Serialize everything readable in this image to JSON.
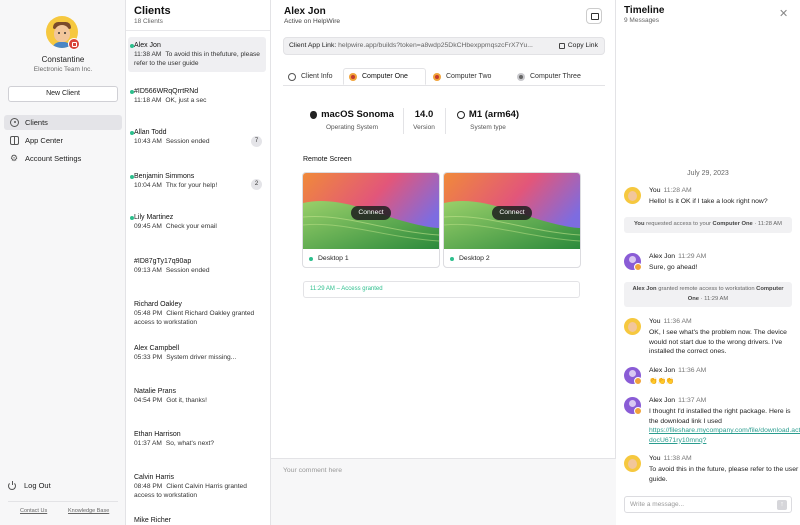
{
  "user": {
    "name": "Constantine",
    "org": "Electronic Team Inc."
  },
  "nav": {
    "new_client": "New Client",
    "items": [
      {
        "label": "Clients",
        "icon": "person-circle-icon"
      },
      {
        "label": "App Center",
        "icon": "grid-icon"
      },
      {
        "label": "Account Settings",
        "icon": "gear-icon"
      }
    ],
    "logout": "Log Out",
    "contact_us": "Contact Us",
    "knowledge_base": "Knowledge Base"
  },
  "clients": {
    "title": "Clients",
    "count": "18 Clients",
    "list": [
      {
        "name": "Alex Jon",
        "time": "11:38 AM",
        "msg": "To avoid this in thefuture, please refer to the user guide",
        "online": true,
        "badge": ""
      },
      {
        "name": "#ID566WRqQrrtRNd",
        "time": "11:18 AM",
        "msg": "OK, just a sec",
        "online": true,
        "badge": ""
      },
      {
        "name": "Allan Todd",
        "time": "10:43 AM",
        "msg": "Session ended",
        "online": true,
        "badge": "7"
      },
      {
        "name": "Benjamin Simmons",
        "time": "10:04 AM",
        "msg": "Thx for your help!",
        "online": true,
        "badge": "2"
      },
      {
        "name": "Lily Martinez",
        "time": "09:45 AM",
        "msg": "Check your email",
        "online": true,
        "badge": ""
      },
      {
        "name": "#ID87gTy17q90ap",
        "time": "09:13 AM",
        "msg": "Session ended",
        "online": false,
        "badge": ""
      },
      {
        "name": "Richard Oakley",
        "time": "05:48 PM",
        "msg": "Client Richard Oakley granted access to workstation",
        "online": false,
        "badge": ""
      },
      {
        "name": "Alex Campbell",
        "time": "05:33 PM",
        "msg": "System driver missing...",
        "online": false,
        "badge": ""
      },
      {
        "name": "Natalie Prans",
        "time": "04:54 PM",
        "msg": "Got it, thanks!",
        "online": false,
        "badge": ""
      },
      {
        "name": "Ethan Harrison",
        "time": "01:37 AM",
        "msg": "So, what's next?",
        "online": false,
        "badge": ""
      },
      {
        "name": "Calvin Harris",
        "time": "08:48 PM",
        "msg": "Client Calvin Harris granted access to workstation",
        "online": false,
        "badge": ""
      },
      {
        "name": "Mike Richer",
        "time": "",
        "msg": "",
        "online": false,
        "badge": ""
      }
    ]
  },
  "main": {
    "name": "Alex Jon",
    "status": "Active on HelpWire",
    "link_label": "Client App Link:",
    "link_url": "helpwire.app/builds?token=a8wdp25DkCHbexppmqszcFrX7Yu...",
    "copy_label": "Copy Link",
    "tabs": [
      {
        "label": "Client Info"
      },
      {
        "label": "Computer One"
      },
      {
        "label": "Computer Two"
      },
      {
        "label": "Computer Three"
      }
    ],
    "specs": [
      {
        "value": "macOS Sonoma",
        "key": "Operating System"
      },
      {
        "value": "14.0",
        "key": "Version"
      },
      {
        "value": "M1 (arm64)",
        "key": "System type"
      }
    ],
    "remote_screen_label": "Remote Screen",
    "desktops": [
      {
        "label": "Desktop 1",
        "connect": "Connect"
      },
      {
        "label": "Desktop 2",
        "connect": "Connect"
      }
    ],
    "access_line": "11:29 AM – Access granted",
    "comment_placeholder": "Your comment here"
  },
  "timeline": {
    "title": "Timeline",
    "count": "9 Messages",
    "date": "July 29, 2023",
    "msg1": {
      "author": "You",
      "time": "11:28 AM",
      "text": "Hello! Is it OK if I take a look right now?"
    },
    "sys1": {
      "pre": "You",
      "mid": " requested access to your ",
      "target": "Computer One",
      "time": " · 11:28 AM"
    },
    "msg2": {
      "author": "Alex Jon",
      "time": "11:29 AM",
      "text": "Sure, go ahead!"
    },
    "sys2": {
      "pre": "Alex Jon",
      "mid": " granted remote access to workstation ",
      "target": "Computer One",
      "time": " · 11:29 AM"
    },
    "msg3": {
      "author": "You",
      "time": "11:36 AM",
      "text": "OK, I see what's the problem now. The device would not start due to the wrong drivers. I've installed the correct ones."
    },
    "msg4": {
      "author": "Alex Jon",
      "time": "11:36 AM",
      "text": "👏👏👏"
    },
    "msg5": {
      "author": "Alex Jon",
      "time": "11:37 AM",
      "text": "I thought I'd installed the right package. Here is the download link I used ",
      "link": "https://fileshare.mycompany.com/file/download.action?docU671ry10mnq?"
    },
    "msg6": {
      "author": "You",
      "time": "11:38 AM",
      "text": "To avoid this in the future, please refer to the user guide."
    },
    "input_placeholder": "Write a message..."
  },
  "colors": {
    "accent": "#2dbf8d",
    "link": "#2a9d8f",
    "badge": "#d9453a"
  }
}
